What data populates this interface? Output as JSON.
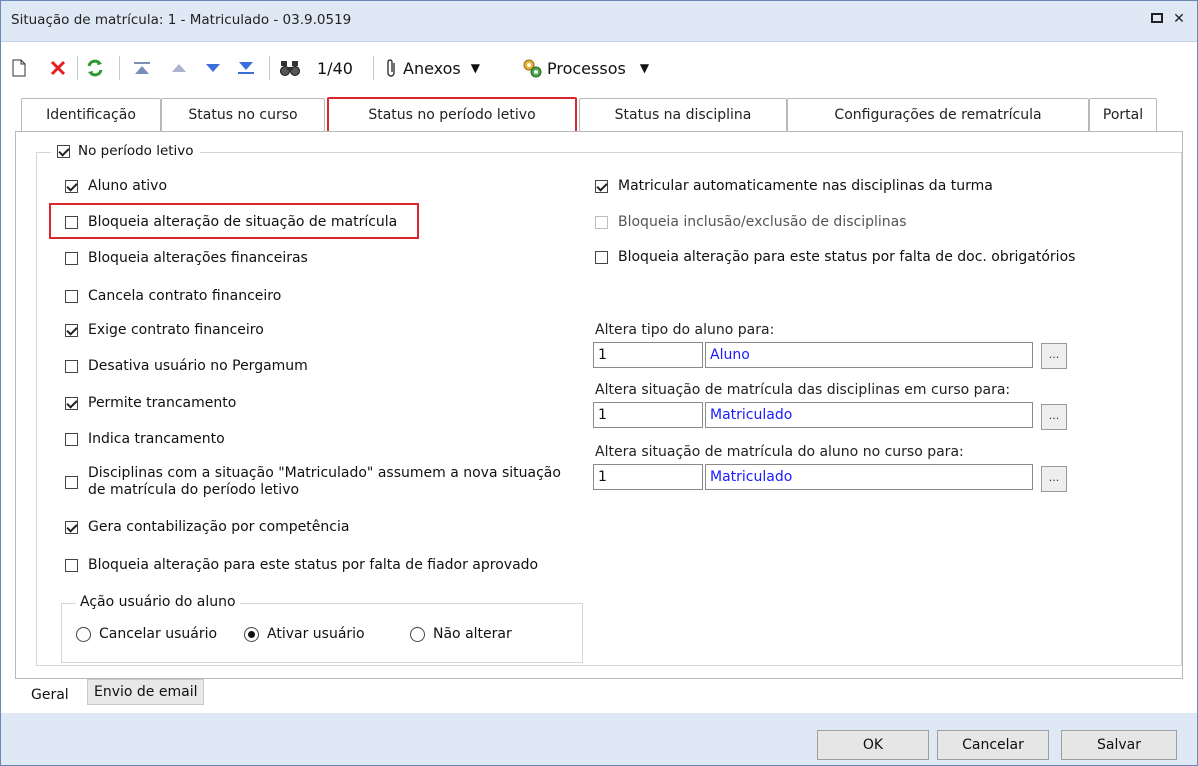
{
  "window": {
    "title": "Situação de matrícula: 1 - Matriculado - 03.9.0519"
  },
  "toolbar": {
    "record_counter": "1/40",
    "anexos_label": "Anexos",
    "processos_label": "Processos"
  },
  "tabs": [
    {
      "label": "Identificação"
    },
    {
      "label": "Status no curso"
    },
    {
      "label": "Status no período letivo",
      "active": true
    },
    {
      "label": "Status na disciplina"
    },
    {
      "label": "Configurações de rematrícula"
    },
    {
      "label": "Portal"
    }
  ],
  "group": {
    "label": "No período letivo",
    "checked": true
  },
  "left_options": [
    {
      "label": "Aluno ativo",
      "checked": true
    },
    {
      "label": "Bloqueia alteração de situação de matrícula",
      "checked": false,
      "highlighted": true
    },
    {
      "label": "Bloqueia alterações financeiras",
      "checked": false
    },
    {
      "label": "Cancela contrato financeiro",
      "checked": false
    },
    {
      "label": "Exige contrato financeiro",
      "checked": true
    },
    {
      "label": "Desativa usuário no Pergamum",
      "checked": false
    },
    {
      "label": "Permite trancamento",
      "checked": true
    },
    {
      "label": "Indica trancamento",
      "checked": false
    },
    {
      "label_line1": "Disciplinas com a situação \"Matriculado\" assumem a nova situação",
      "label_line2": "de matrícula do período letivo",
      "checked": false
    },
    {
      "label": "Gera contabilização por competência",
      "checked": true
    },
    {
      "label": "Bloqueia alteração para este status por falta de fiador aprovado",
      "checked": false
    }
  ],
  "right_options": [
    {
      "label": "Matricular automaticamente nas disciplinas da turma",
      "checked": true
    },
    {
      "label": "Bloqueia inclusão/exclusão de disciplinas",
      "checked": false,
      "disabled": true
    },
    {
      "label": "Bloqueia alteração para este status por falta de doc. obrigatórios",
      "checked": false
    }
  ],
  "fields": [
    {
      "label": "Altera tipo do aluno para:",
      "code": "1",
      "value": "Aluno",
      "button": "..."
    },
    {
      "label": "Altera situação de matrícula das disciplinas em curso para:",
      "code": "1",
      "value": "Matriculado",
      "button": "..."
    },
    {
      "label": "Altera situação de matrícula do aluno no curso para:",
      "code": "1",
      "value": "Matriculado",
      "button": "..."
    }
  ],
  "acao_usuario": {
    "label": "Ação usuário do aluno",
    "options": [
      {
        "label": "Cancelar usuário",
        "selected": false
      },
      {
        "label": "Ativar usuário",
        "selected": true
      },
      {
        "label": "Não alterar",
        "selected": false
      }
    ]
  },
  "bottom_tabs": [
    {
      "label": "Geral",
      "active": true
    },
    {
      "label": "Envio de email",
      "active": false
    }
  ],
  "footer": {
    "ok": "OK",
    "cancel": "Cancelar",
    "save": "Salvar"
  },
  "colors": {
    "highlight": "#d9272e",
    "titlebar": "#dfe8f5",
    "link_blue": "#1a1aff"
  }
}
